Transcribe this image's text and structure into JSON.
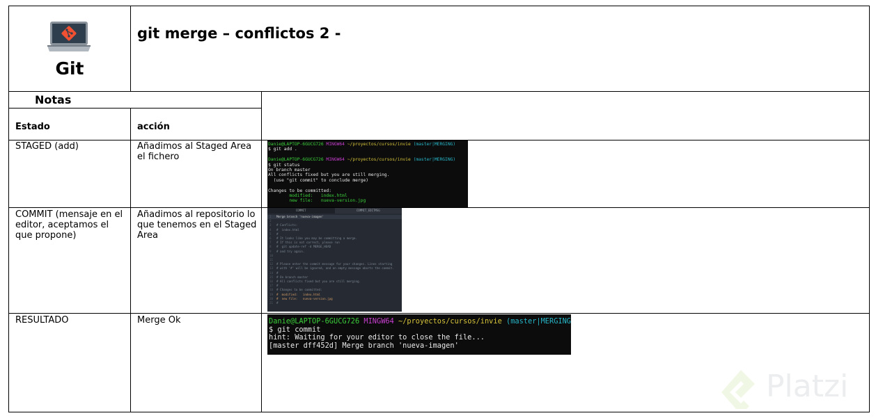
{
  "header": {
    "logo_text": "Git",
    "title": "git merge – conflictos 2 -"
  },
  "notes": {
    "label": "Notas",
    "col_state": "Estado",
    "col_action": "acción"
  },
  "rows": [
    {
      "state": "STAGED (add)",
      "action": "Añadimos al Staged Area el fichero"
    },
    {
      "state": "COMMIT (mensaje en el editor, aceptamos el que propone)",
      "action": "Añadimos al repositorio lo que tenemos en el Staged Area"
    },
    {
      "state": "RESULTADO",
      "action": "Merge Ok"
    }
  ],
  "terminal1": {
    "prompt_user": "Danie@LAPTOP-6GUCG726",
    "prompt_env": "MINGW64",
    "prompt_path": "~/proyectos/cursos/invie",
    "prompt_branch": "(master|MERGING)",
    "cmd1": "$ git add .",
    "cmd2": "$ git status",
    "out1": "On branch master",
    "out2": "All conflicts fixed but you are still merging.",
    "out3": "  (use \"git commit\" to conclude merge)",
    "out4": "Changes to be committed:",
    "out5": "        modified:   index.html",
    "out6": "        new file:   nueva-version.jpg"
  },
  "editor": {
    "tab1": "COMMIT",
    "tab2": "COMMIT_EDITMSG",
    "lines": [
      "Merge branch 'nueva-imagen'",
      "",
      "# Conflicts:",
      "#  index.html",
      "#",
      "# It looks like you may be committing a merge.",
      "# If this is not correct, please run",
      "#  git update-ref -d MERGE_HEAD",
      "# and try again.",
      "",
      "",
      "# Please enter the commit message for your changes. Lines starting",
      "# with '#' will be ignored, and an empty message aborts the commit.",
      "#",
      "# On branch master",
      "# All conflicts fixed but you are still merging.",
      "#",
      "# Changes to be committed:",
      "#  modified:   index.html",
      "#  new file:   nueva-version.jpg",
      "#"
    ]
  },
  "terminal2": {
    "prompt_user": "Danie@LAPTOP-6GUCG726",
    "prompt_env": "MINGW64",
    "prompt_path": "~/proyectos/cursos/invie",
    "prompt_branch": "(master|MERGING)",
    "cmd": "$ git commit",
    "out1": "hint: Waiting for your editor to close the file...",
    "out2": "[master dff452d] Merge branch 'nueva-imagen'"
  },
  "watermark": "Platzi",
  "colors": {
    "git_orange": "#f05133",
    "laptop_gray": "#8a929b",
    "terminal_bg": "#0c0c0c"
  }
}
